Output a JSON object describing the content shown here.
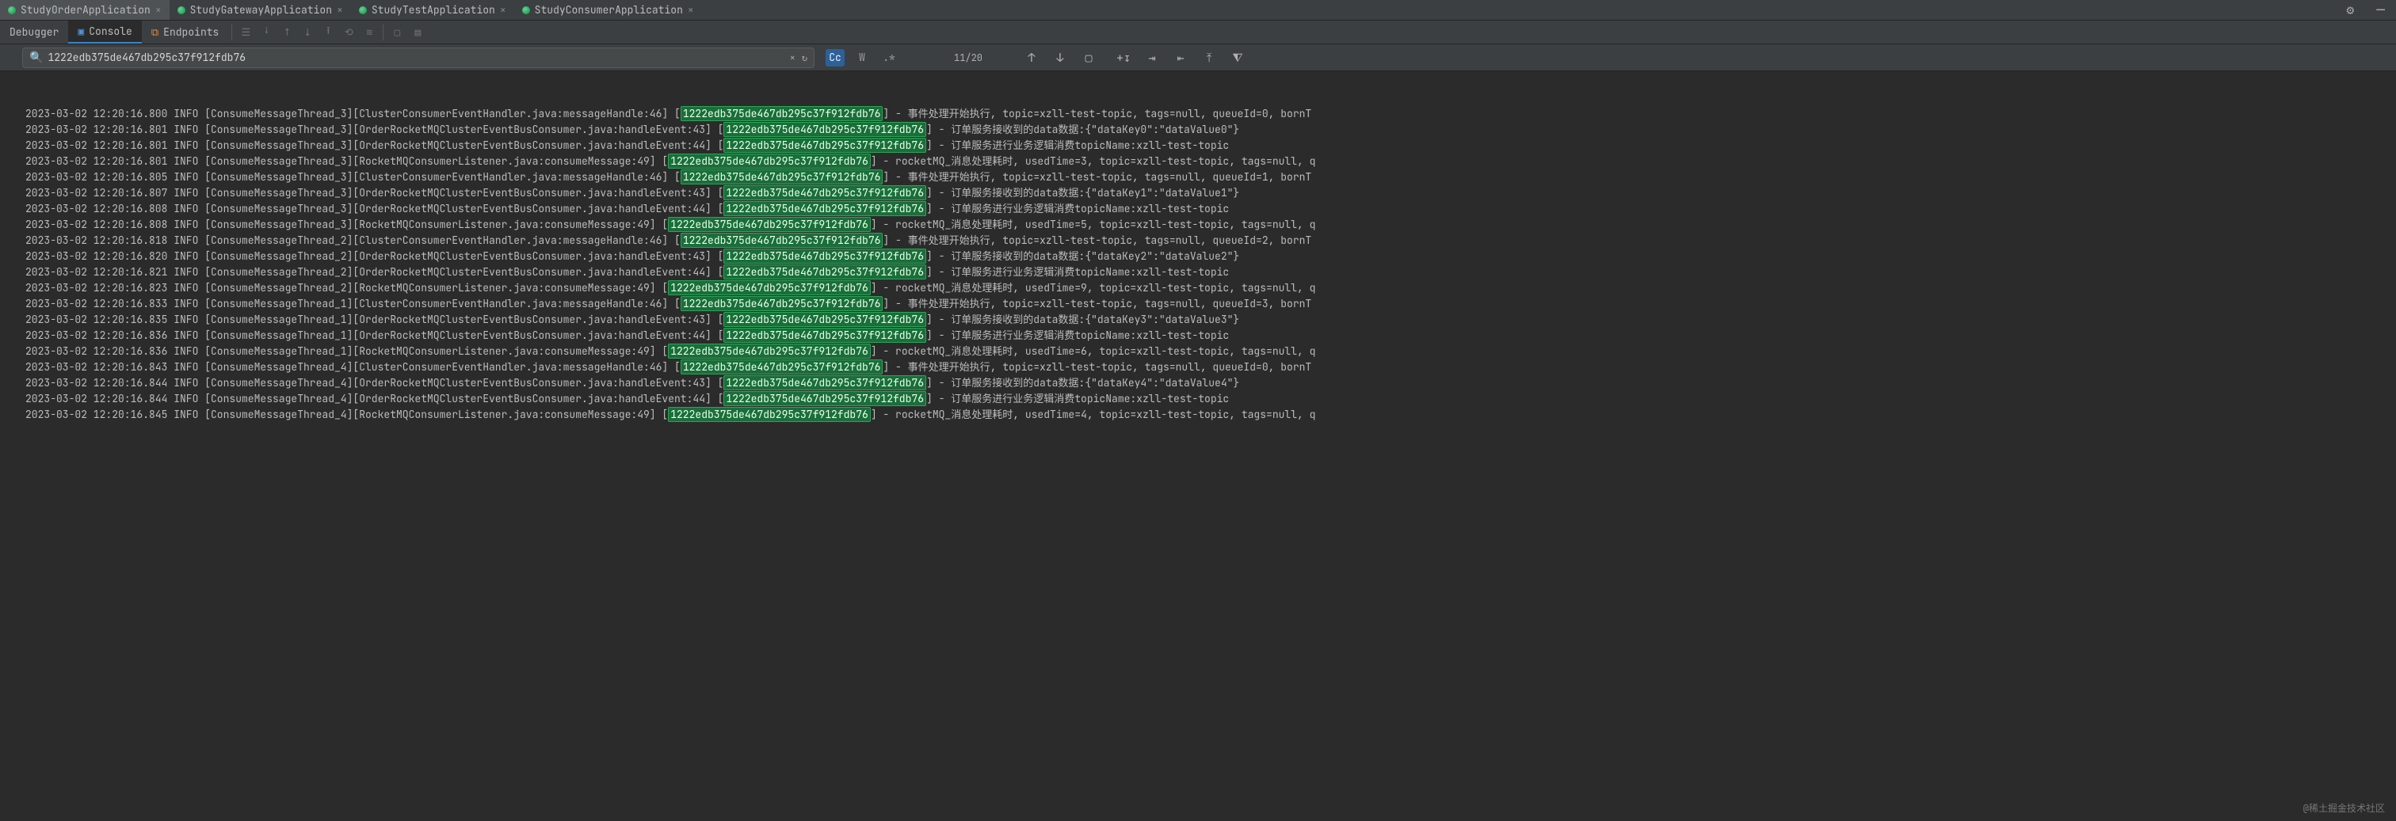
{
  "tabs": [
    {
      "label": "StudyOrderApplication",
      "active": true
    },
    {
      "label": "StudyGatewayApplication",
      "active": false
    },
    {
      "label": "StudyTestApplication",
      "active": false
    },
    {
      "label": "StudyConsumerApplication",
      "active": false
    }
  ],
  "toolrow": {
    "debugger": "Debugger",
    "console": "Console",
    "endpoints": "Endpoints"
  },
  "search": {
    "value": "1222edb375de467db295c37f912fdb76",
    "count": "11/20"
  },
  "traceId": "1222edb375de467db295c37f912fdb76",
  "logs": [
    {
      "pre": "2023-03-02 12:20:16.800 INFO [ConsumeMessageThread_3][ClusterConsumerEventHandler.java:messageHandle:46] [",
      "post": "] - 事件处理开始执行, topic=xzll-test-topic, tags=null, queueId=0, bornT"
    },
    {
      "pre": "2023-03-02 12:20:16.801 INFO [ConsumeMessageThread_3][OrderRocketMQClusterEventBusConsumer.java:handleEvent:43] [",
      "post": "] - 订单服务接收到的data数据:{\"dataKey0\":\"dataValue0\"}"
    },
    {
      "pre": "2023-03-02 12:20:16.801 INFO [ConsumeMessageThread_3][OrderRocketMQClusterEventBusConsumer.java:handleEvent:44] [",
      "post": "] - 订单服务进行业务逻辑消费topicName:xzll-test-topic"
    },
    {
      "pre": "2023-03-02 12:20:16.801 INFO [ConsumeMessageThread_3][RocketMQConsumerListener.java:consumeMessage:49] [",
      "post": "] - rocketMQ_消息处理耗时, usedTime=3, topic=xzll-test-topic, tags=null, q"
    },
    {
      "pre": "2023-03-02 12:20:16.805 INFO [ConsumeMessageThread_3][ClusterConsumerEventHandler.java:messageHandle:46] [",
      "post": "] - 事件处理开始执行, topic=xzll-test-topic, tags=null, queueId=1, bornT"
    },
    {
      "pre": "2023-03-02 12:20:16.807 INFO [ConsumeMessageThread_3][OrderRocketMQClusterEventBusConsumer.java:handleEvent:43] [",
      "post": "] - 订单服务接收到的data数据:{\"dataKey1\":\"dataValue1\"}"
    },
    {
      "pre": "2023-03-02 12:20:16.808 INFO [ConsumeMessageThread_3][OrderRocketMQClusterEventBusConsumer.java:handleEvent:44] [",
      "post": "] - 订单服务进行业务逻辑消费topicName:xzll-test-topic"
    },
    {
      "pre": "2023-03-02 12:20:16.808 INFO [ConsumeMessageThread_3][RocketMQConsumerListener.java:consumeMessage:49] [",
      "post": "] - rocketMQ_消息处理耗时, usedTime=5, topic=xzll-test-topic, tags=null, q"
    },
    {
      "pre": "2023-03-02 12:20:16.818 INFO [ConsumeMessageThread_2][ClusterConsumerEventHandler.java:messageHandle:46] [",
      "post": "] - 事件处理开始执行, topic=xzll-test-topic, tags=null, queueId=2, bornT"
    },
    {
      "pre": "2023-03-02 12:20:16.820 INFO [ConsumeMessageThread_2][OrderRocketMQClusterEventBusConsumer.java:handleEvent:43] [",
      "post": "] - 订单服务接收到的data数据:{\"dataKey2\":\"dataValue2\"}"
    },
    {
      "pre": "2023-03-02 12:20:16.821 INFO [ConsumeMessageThread_2][OrderRocketMQClusterEventBusConsumer.java:handleEvent:44] [",
      "post": "] - 订单服务进行业务逻辑消费topicName:xzll-test-topic"
    },
    {
      "pre": "2023-03-02 12:20:16.823 INFO [ConsumeMessageThread_2][RocketMQConsumerListener.java:consumeMessage:49] [",
      "post": "] - rocketMQ_消息处理耗时, usedTime=9, topic=xzll-test-topic, tags=null, q"
    },
    {
      "pre": "2023-03-02 12:20:16.833 INFO [ConsumeMessageThread_1][ClusterConsumerEventHandler.java:messageHandle:46] [",
      "post": "] - 事件处理开始执行, topic=xzll-test-topic, tags=null, queueId=3, bornT"
    },
    {
      "pre": "2023-03-02 12:20:16.835 INFO [ConsumeMessageThread_1][OrderRocketMQClusterEventBusConsumer.java:handleEvent:43] [",
      "post": "] - 订单服务接收到的data数据:{\"dataKey3\":\"dataValue3\"}"
    },
    {
      "pre": "2023-03-02 12:20:16.836 INFO [ConsumeMessageThread_1][OrderRocketMQClusterEventBusConsumer.java:handleEvent:44] [",
      "post": "] - 订单服务进行业务逻辑消费topicName:xzll-test-topic"
    },
    {
      "pre": "2023-03-02 12:20:16.836 INFO [ConsumeMessageThread_1][RocketMQConsumerListener.java:consumeMessage:49] [",
      "post": "] - rocketMQ_消息处理耗时, usedTime=6, topic=xzll-test-topic, tags=null, q"
    },
    {
      "pre": "2023-03-02 12:20:16.843 INFO [ConsumeMessageThread_4][ClusterConsumerEventHandler.java:messageHandle:46] [",
      "post": "] - 事件处理开始执行, topic=xzll-test-topic, tags=null, queueId=0, bornT"
    },
    {
      "pre": "2023-03-02 12:20:16.844 INFO [ConsumeMessageThread_4][OrderRocketMQClusterEventBusConsumer.java:handleEvent:43] [",
      "post": "] - 订单服务接收到的data数据:{\"dataKey4\":\"dataValue4\"}"
    },
    {
      "pre": "2023-03-02 12:20:16.844 INFO [ConsumeMessageThread_4][OrderRocketMQClusterEventBusConsumer.java:handleEvent:44] [",
      "post": "] - 订单服务进行业务逻辑消费topicName:xzll-test-topic"
    },
    {
      "pre": "2023-03-02 12:20:16.845 INFO [ConsumeMessageThread_4][RocketMQConsumerListener.java:consumeMessage:49] [",
      "post": "] - rocketMQ_消息处理耗时, usedTime=4, topic=xzll-test-topic, tags=null, q"
    }
  ],
  "watermark": "@稀土掘金技术社区"
}
